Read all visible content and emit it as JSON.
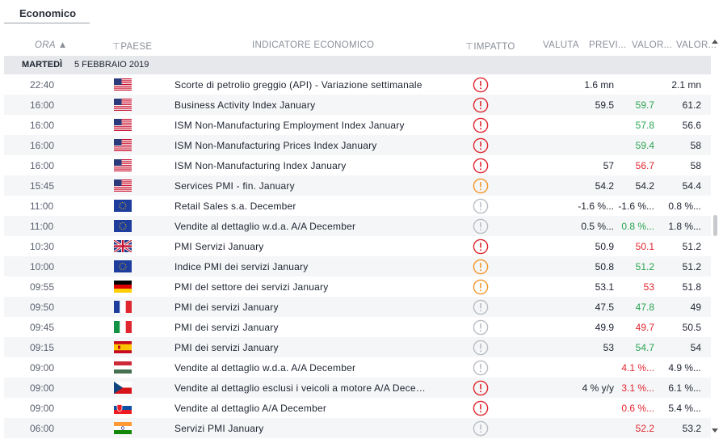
{
  "tab": {
    "label": "Economico"
  },
  "headers": {
    "ora": "ORA ▲",
    "paese": "PAESE",
    "indicatore": "INDICATORE ECONOMICO",
    "impatto": "IMPATTO",
    "valuta": "VALUTA",
    "previsto": "PREVI...",
    "valore_attuale": "VALOR...",
    "valore_prec": "VALOR..."
  },
  "date_group": {
    "day": "MARTEDÌ",
    "date": "5 FEBBRAIO 2019"
  },
  "colors": {
    "high": "#e0262f",
    "medium": "#f2962b",
    "low": "#b9bdc3",
    "positive": "#2aa451",
    "negative": "#e0262f"
  },
  "rows": [
    {
      "time": "22:40",
      "flag": "us",
      "indicator": "Scorte di petrolio greggio (API) - Variazione settimanale",
      "impact": "high",
      "forecast": "1.6 mn",
      "actual": "",
      "actual_color": "",
      "previous": "2.1 mn"
    },
    {
      "time": "16:00",
      "flag": "us",
      "indicator": "Business Activity Index January",
      "impact": "high",
      "forecast": "59.5",
      "actual": "59.7",
      "actual_color": "g",
      "previous": "61.2"
    },
    {
      "time": "16:00",
      "flag": "us",
      "indicator": "ISM Non-Manufacturing Employment Index January",
      "impact": "high",
      "forecast": "",
      "actual": "57.8",
      "actual_color": "g",
      "previous": "56.6"
    },
    {
      "time": "16:00",
      "flag": "us",
      "indicator": "ISM Non-Manufacturing Prices Index January",
      "impact": "high",
      "forecast": "",
      "actual": "59.4",
      "actual_color": "g",
      "previous": "58"
    },
    {
      "time": "16:00",
      "flag": "us",
      "indicator": "ISM Non-Manufacturing Index January",
      "impact": "high",
      "forecast": "57",
      "actual": "56.7",
      "actual_color": "r",
      "previous": "58"
    },
    {
      "time": "15:45",
      "flag": "us",
      "indicator": "Services PMI - fin. January",
      "impact": "medium",
      "forecast": "54.2",
      "actual": "54.2",
      "actual_color": "",
      "previous": "54.4"
    },
    {
      "time": "11:00",
      "flag": "eu",
      "indicator": "Retail Sales s.a. December",
      "impact": "low",
      "forecast": "-1.6 %...",
      "actual": "-1.6 %...",
      "actual_color": "",
      "previous": "0.8 %..."
    },
    {
      "time": "11:00",
      "flag": "eu",
      "indicator": "Vendite al dettaglio w.d.a. A/A December",
      "impact": "low",
      "forecast": "0.5 %...",
      "actual": "0.8 %...",
      "actual_color": "g",
      "previous": "1.8 %..."
    },
    {
      "time": "10:30",
      "flag": "gb",
      "indicator": "PMI Servizi January",
      "impact": "high",
      "forecast": "50.9",
      "actual": "50.1",
      "actual_color": "r",
      "previous": "51.2"
    },
    {
      "time": "10:00",
      "flag": "eu",
      "indicator": "Indice PMI dei servizi January",
      "impact": "medium",
      "forecast": "50.8",
      "actual": "51.2",
      "actual_color": "g",
      "previous": "51.2"
    },
    {
      "time": "09:55",
      "flag": "de",
      "indicator": "PMI del settore dei servizi January",
      "impact": "medium",
      "forecast": "53.1",
      "actual": "53",
      "actual_color": "r",
      "previous": "51.8"
    },
    {
      "time": "09:50",
      "flag": "fr",
      "indicator": "PMI dei servizi January",
      "impact": "low",
      "forecast": "47.5",
      "actual": "47.8",
      "actual_color": "g",
      "previous": "49"
    },
    {
      "time": "09:45",
      "flag": "it",
      "indicator": "PMI dei servizi January",
      "impact": "low",
      "forecast": "49.9",
      "actual": "49.7",
      "actual_color": "r",
      "previous": "50.5"
    },
    {
      "time": "09:15",
      "flag": "es",
      "indicator": "PMI dei servizi January",
      "impact": "low",
      "forecast": "53",
      "actual": "54.7",
      "actual_color": "g",
      "previous": "54"
    },
    {
      "time": "09:00",
      "flag": "hu",
      "indicator": "Vendite al dettaglio w.d.a. A/A December",
      "impact": "low",
      "forecast": "",
      "actual": "4.1 %...",
      "actual_color": "r",
      "previous": "4.9 %..."
    },
    {
      "time": "09:00",
      "flag": "cz",
      "indicator": "Vendite al dettaglio esclusi i veicoli a motore A/A December",
      "impact": "high",
      "forecast": "4 % y/y",
      "actual": "3.1 %...",
      "actual_color": "r",
      "previous": "6.1 %..."
    },
    {
      "time": "09:00",
      "flag": "sk",
      "indicator": "Vendite al dettaglio A/A December",
      "impact": "high",
      "forecast": "",
      "actual": "0.6 %...",
      "actual_color": "r",
      "previous": "5.4 %..."
    },
    {
      "time": "06:00",
      "flag": "in",
      "indicator": "Servizi PMI January",
      "impact": "low",
      "forecast": "",
      "actual": "52.2",
      "actual_color": "r",
      "previous": "53.2"
    }
  ]
}
